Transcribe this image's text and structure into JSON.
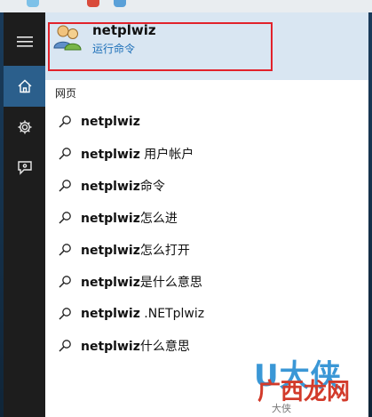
{
  "best_match": {
    "title": "netplwiz",
    "subtitle": "运行命令"
  },
  "section_label": "网页",
  "suggestions": [
    {
      "bold": "netplwiz",
      "rest": ""
    },
    {
      "bold": "netplwiz",
      "rest": " 用户帐户"
    },
    {
      "bold": "netplwiz",
      "rest": "命令"
    },
    {
      "bold": "netplwiz",
      "rest": "怎么进"
    },
    {
      "bold": "netplwiz",
      "rest": "怎么打开"
    },
    {
      "bold": "netplwiz",
      "rest": "是什么意思"
    },
    {
      "bold": "netplwiz",
      "rest": " .NETplwiz"
    },
    {
      "bold": "netplwiz",
      "rest": "什么意思"
    }
  ],
  "rail": {
    "items": [
      "menu-icon",
      "home-icon",
      "gear-icon",
      "feedback-icon"
    ]
  },
  "watermark": {
    "brand": "U大侠",
    "site": "广西龙网",
    "bottom": "大侠"
  },
  "colors": {
    "highlight_border": "#e2222b",
    "subtitle": "#1c6fb8",
    "rail_active": "#2b5f8c"
  }
}
